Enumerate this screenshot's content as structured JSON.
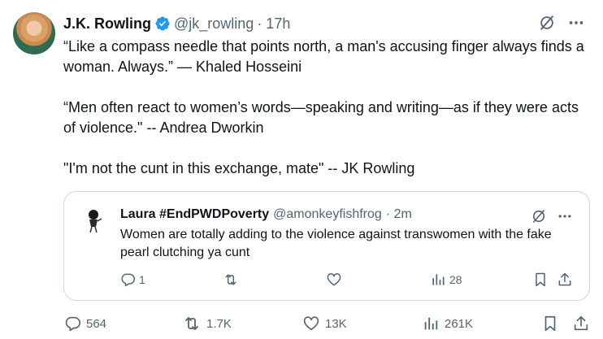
{
  "tweet": {
    "author": {
      "name": "J.K. Rowling",
      "handle": "@jk_rowling",
      "time": "· 17h"
    },
    "paragraphs": [
      "“Like a compass needle that points north, a man's accusing finger always finds a woman. Always.” — Khaled Hosseini",
      "“Men often react to women’s words—speaking and writing—as if they were acts of violence.\" -- Andrea Dworkin",
      "\"I'm not the cunt in this exchange, mate\" -- JK Rowling"
    ],
    "quoted": {
      "name": "Laura #EndPWDPoverty",
      "handle": "@amonkeyfishfrog",
      "time": "· 2m",
      "text": "Women are totally adding to the violence against transwomen with the fake pearl clutching ya cunt",
      "counts": {
        "replies": "1",
        "views": "28"
      }
    },
    "counts": {
      "replies": "564",
      "reposts": "1.7K",
      "likes": "13K",
      "views": "261K"
    }
  },
  "colors": {
    "text": "#0f1419",
    "secondary": "#536471",
    "verified": "#1d9bf0",
    "border": "#cfd9de"
  },
  "icons": [
    "verified-badge-icon",
    "grok-icon",
    "more-icon",
    "reply-icon",
    "repost-icon",
    "like-icon",
    "views-icon",
    "bookmark-icon",
    "share-icon"
  ]
}
